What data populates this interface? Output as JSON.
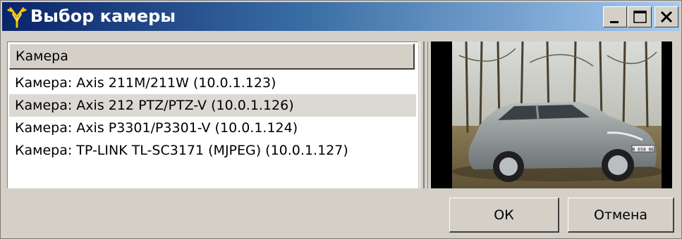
{
  "window": {
    "title": "Выбор камеры",
    "controls": {
      "minimize_icon": "minimize-icon",
      "maximize_icon": "maximize-icon",
      "close_icon": "close-icon"
    }
  },
  "camera_list": {
    "column_header": "Камера",
    "selected_index": 1,
    "items": [
      {
        "label": "Камера: Axis 211M/211W (10.0.1.123)"
      },
      {
        "label": "Камера: Axis 212 PTZ/PTZ-V (10.0.1.126)"
      },
      {
        "label": "Камера: Axis P3301/P3301-V (10.0.1.124)"
      },
      {
        "label": "Камера: TP-LINK TL-SC3171 (MJPEG) (10.0.1.127)"
      }
    ]
  },
  "preview": {
    "image_subject": "silver sedan car parked near trees",
    "plate_text": "В 658 ВЕ"
  },
  "buttons": {
    "ok_label": "ОК",
    "cancel_label": "Отмена"
  },
  "colors": {
    "title_gradient_start": "#0a246a",
    "title_gradient_end": "#a6caf0",
    "window_bg": "#d4d0c8",
    "selected_row": "#dcd9d4"
  }
}
